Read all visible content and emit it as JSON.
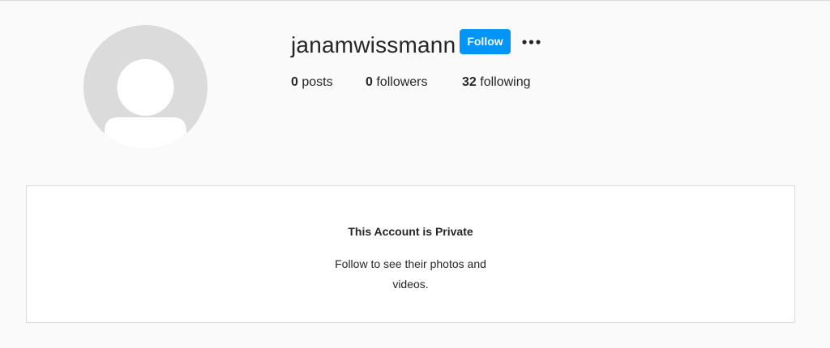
{
  "profile": {
    "username": "janamwissmann",
    "follow_label": "Follow",
    "more_icon": "ellipsis-icon",
    "avatar_icon": "default-avatar-icon",
    "stats": {
      "posts_count": "0",
      "posts_label": "posts",
      "followers_count": "0",
      "followers_label": "followers",
      "following_count": "32",
      "following_label": "following"
    }
  },
  "private_notice": {
    "title": "This Account is Private",
    "message": "Follow to see their photos and videos."
  },
  "colors": {
    "background": "#fafafa",
    "accent": "#0095f6",
    "border": "#dbdbdb",
    "text": "#262626",
    "avatar": "#dbdbdb"
  }
}
